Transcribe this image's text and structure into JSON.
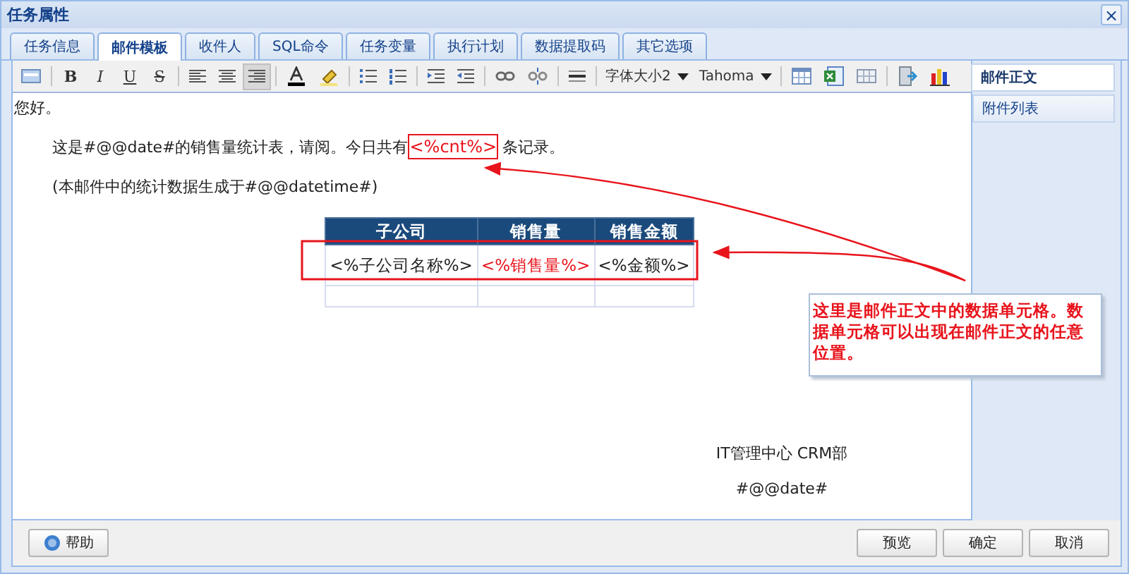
{
  "window": {
    "title": "任务属性",
    "close": "×"
  },
  "tabs": [
    {
      "label": "任务信息",
      "selected": false
    },
    {
      "label": "邮件模板",
      "selected": true
    },
    {
      "label": "收件人",
      "selected": false
    },
    {
      "label": "SQL命令",
      "selected": false
    },
    {
      "label": "任务变量",
      "selected": false
    },
    {
      "label": "执行计划",
      "selected": false
    },
    {
      "label": "数据提取码",
      "selected": false
    },
    {
      "label": "其它选项",
      "selected": false
    }
  ],
  "toolbar": {
    "style_buttons": [
      "B",
      "I",
      "U",
      "S"
    ],
    "align_buttons": [
      {
        "selected": false
      },
      {
        "selected": false
      },
      {
        "selected": true
      }
    ],
    "font_size": "字体大小2",
    "font_family": "Tahoma"
  },
  "side_panel": [
    {
      "label": "邮件正文",
      "selected": true
    },
    {
      "label": "附件列表",
      "selected": false
    }
  ],
  "editor": {
    "greeting": "您好。",
    "line_1": {
      "before": "这是#@@date#的销售量统计表，请阅。今日共有",
      "token": "<%cnt%>",
      "after": "条记录。"
    },
    "line_2": "(本邮件中的统计数据生成于#@@datetime#)",
    "table": {
      "columns": [
        "子公司",
        "销售量",
        "销售金额"
      ],
      "rows": [
        [
          {
            "text": "<%子公司名称%>",
            "highlight": false
          },
          {
            "text": "<%销售量%>",
            "highlight": true
          },
          {
            "text": "<%金额%>",
            "highlight": false
          }
        ]
      ]
    },
    "callout": "这里是邮件正文中的数据单元格。数据单元格可以出现在邮件正文的任意位置。",
    "signature": [
      "IT管理中心 CRM部",
      "#@@date#"
    ]
  },
  "footer": {
    "help": "帮助",
    "buttons": [
      "预览",
      "确定",
      "取消"
    ]
  }
}
